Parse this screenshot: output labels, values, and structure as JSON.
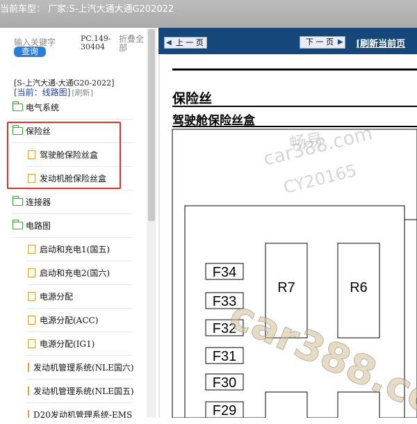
{
  "window": {
    "title": "当前车型：  厂家:S-上汽大通大通G202022"
  },
  "sidebar": {
    "search_label": "输入关键字",
    "search_button": "查询",
    "pc_code": "PC.149-30404",
    "collapse_all": "折叠全部",
    "vehicle_line": "[S-上汽大通-大通G20-2022]",
    "current_prefix": "[当前：线路图]",
    "refresh_label": "[刷新]",
    "tree": [
      {
        "label": "电气系统",
        "type": "folder"
      },
      {
        "label": "保险丝",
        "type": "folder-open"
      },
      {
        "label": "驾驶舱保险丝盒",
        "type": "doc"
      },
      {
        "label": "发动机舱保险丝盒",
        "type": "doc"
      },
      {
        "label": "连接器",
        "type": "folder"
      },
      {
        "label": "电路图",
        "type": "folder-open"
      },
      {
        "label": "启动和充电1(国五)",
        "type": "doc"
      },
      {
        "label": "启动和充电2(国六)",
        "type": "doc"
      },
      {
        "label": "电源分配",
        "type": "doc"
      },
      {
        "label": "电源分配(ACC)",
        "type": "doc"
      },
      {
        "label": "电源分配(IG1)",
        "type": "doc"
      },
      {
        "label": "发动机管理系统(NLE国六)",
        "type": "doc"
      },
      {
        "label": "发动机管理系统(NLE国五)",
        "type": "doc"
      },
      {
        "label": "D20发动机管理系统-EMS",
        "type": "doc"
      }
    ]
  },
  "toolbar": {
    "prev_label": "上 一 页",
    "next_label": "下 一 页",
    "refresh_page": "[刷新当前页"
  },
  "document": {
    "heading": "保险丝",
    "subheading": "驾驶舱保险丝盒",
    "fuses": [
      "F34",
      "F33",
      "F32",
      "F31",
      "F30",
      "F29"
    ],
    "relays": [
      "R7",
      "R6"
    ]
  },
  "watermarks": {
    "line1": "畅易",
    "line2": "car388.com",
    "line3": "CY20165",
    "big": "car388.co"
  }
}
